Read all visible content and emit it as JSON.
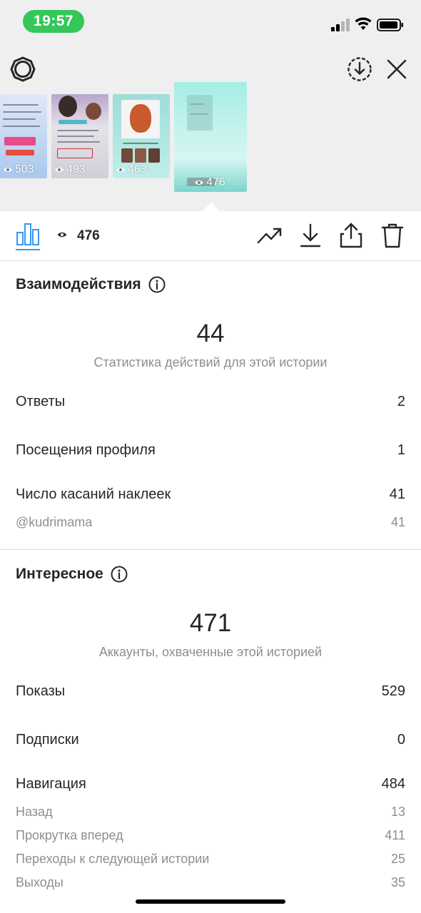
{
  "status_bar": {
    "time": "19:57",
    "time_pill_color": "#34c759"
  },
  "header": {
    "icons": [
      "gear-icon",
      "download-circle-icon",
      "close-icon"
    ]
  },
  "stories": [
    {
      "views": "503"
    },
    {
      "views": "493"
    },
    {
      "views": "463"
    },
    {
      "views": "476",
      "selected": true
    }
  ],
  "toolbar": {
    "active_tab_icon": "bar-chart-icon",
    "view_count": "476",
    "actions": [
      "trend-icon",
      "download-icon",
      "share-icon",
      "trash-icon"
    ],
    "accent_color": "#3897f0"
  },
  "interactions": {
    "title": "Взаимодействия",
    "total": "44",
    "caption": "Статистика действий для этой истории",
    "rows": [
      {
        "label": "Ответы",
        "value": "2"
      },
      {
        "label": "Посещения профиля",
        "value": "1"
      },
      {
        "label": "Число касаний наклеек",
        "value": "41"
      }
    ],
    "sub_rows": [
      {
        "label": "@kudrimama",
        "value": "41"
      }
    ]
  },
  "discovery": {
    "title": "Интересное",
    "total": "471",
    "caption": "Аккаунты, охваченные этой историей",
    "rows": [
      {
        "label": "Показы",
        "value": "529"
      },
      {
        "label": "Подписки",
        "value": "0"
      },
      {
        "label": "Навигация",
        "value": "484"
      }
    ],
    "nav_rows": [
      {
        "label": "Назад",
        "value": "13"
      },
      {
        "label": "Прокрутка вперед",
        "value": "411"
      },
      {
        "label": "Переходы к следующей истории",
        "value": "25"
      },
      {
        "label": "Выходы",
        "value": "35"
      }
    ]
  }
}
